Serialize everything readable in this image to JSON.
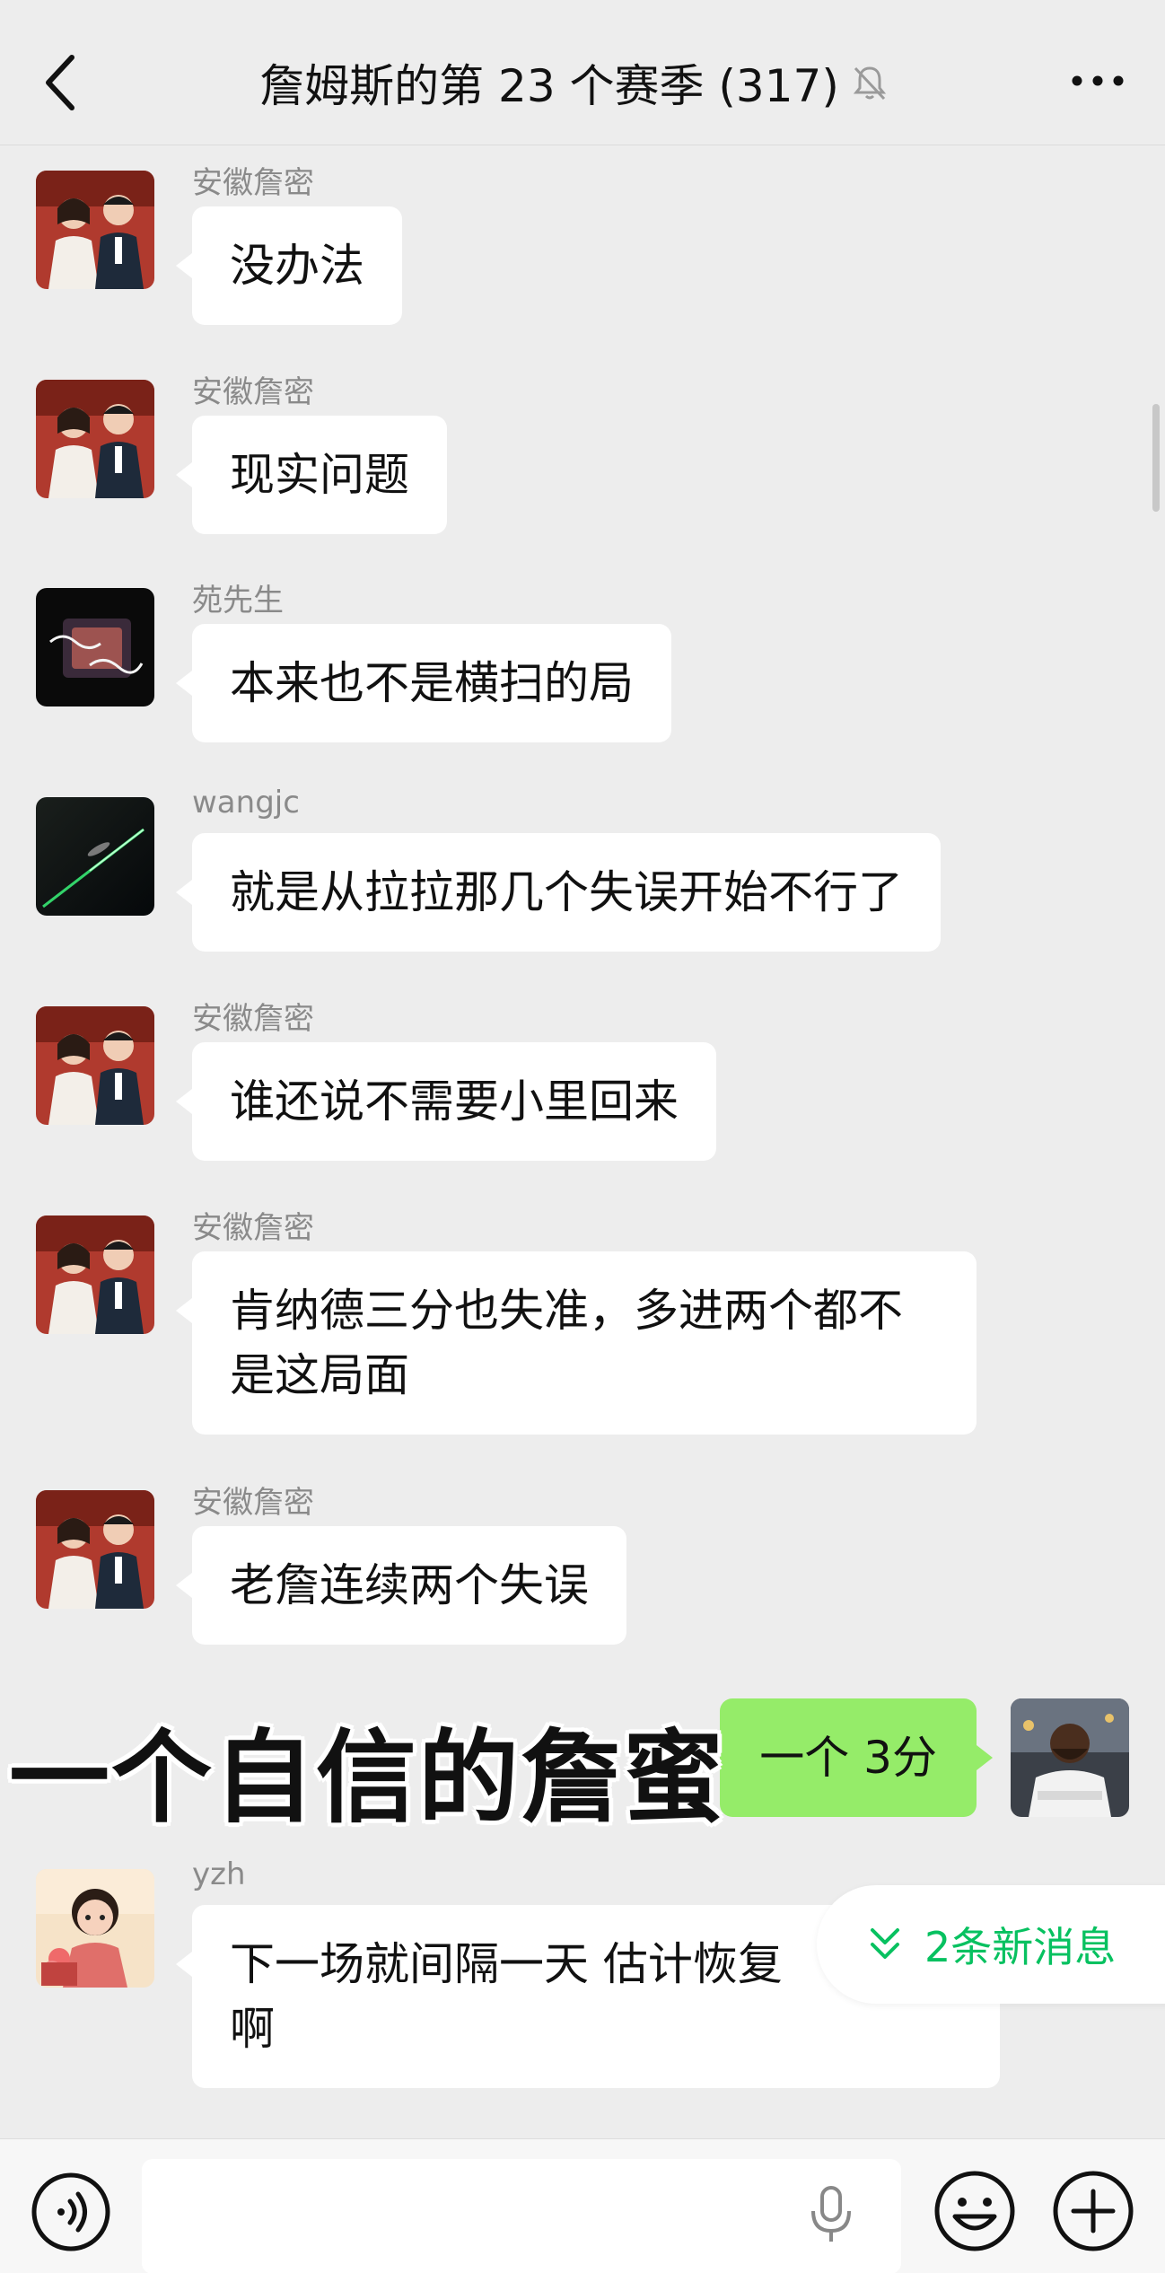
{
  "header": {
    "title": "詹姆斯的第 23 个赛季 (317)"
  },
  "messages": [
    {
      "sender": "安徽詹密",
      "text": "没办法",
      "avatar": "couple-photo-avatar"
    },
    {
      "sender": "安徽詹密",
      "text": "现实问题",
      "avatar": "couple-photo-avatar"
    },
    {
      "sender": "苑先生",
      "text": "本来也不是横扫的局",
      "avatar": "calligraphy-avatar"
    },
    {
      "sender": "wangjc",
      "text": "就是从拉拉那几个失误开始不行了",
      "avatar": "comet-avatar"
    },
    {
      "sender": "安徽詹密",
      "text": "谁还说不需要小里回来",
      "avatar": "couple-photo-avatar"
    },
    {
      "sender": "安徽詹密",
      "text_line1": "肯纳德三分也失准，多进两个都不",
      "text_line2": "是这局面",
      "avatar": "couple-photo-avatar"
    },
    {
      "sender": "安徽詹密",
      "text": "老詹连续两个失误",
      "avatar": "couple-photo-avatar"
    },
    {
      "sender": "yzh",
      "text_line1": "下一场就间隔一天  估计恢复",
      "text_line2": "啊",
      "avatar": "cartoon-girl-avatar"
    }
  ],
  "self_message": {
    "text": "一个 3分",
    "avatar": "man-photo-avatar"
  },
  "overlay_caption": "一个自信的詹蜜",
  "new_messages_badge": "2条新消息",
  "colors": {
    "background": "#ededed",
    "self_bubble": "#95ec69",
    "accent_green": "#07c160"
  },
  "icons": [
    "back-icon",
    "mute-bell-icon",
    "more-icon",
    "voice-icon",
    "mic-icon",
    "emoji-icon",
    "plus-icon",
    "double-chevron-down-icon"
  ]
}
